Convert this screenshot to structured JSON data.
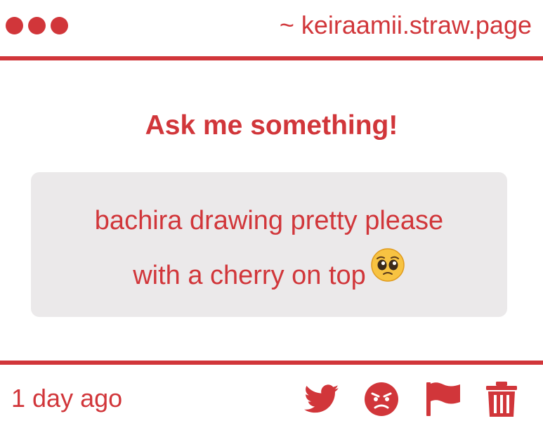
{
  "header": {
    "url": "~ keiraamii.straw.page",
    "window_controls": [
      "dot",
      "dot",
      "dot"
    ]
  },
  "prompt": {
    "title": "Ask me something!"
  },
  "question": {
    "line1": "bachira drawing pretty please",
    "line2": "with a cherry on top",
    "emoji_icon": "pleading-face-icon"
  },
  "footer": {
    "timestamp": "1 day ago",
    "actions": [
      {
        "name": "share-twitter",
        "icon": "twitter-bird-icon"
      },
      {
        "name": "angry-reaction",
        "icon": "angry-face-icon"
      },
      {
        "name": "report",
        "icon": "flag-icon"
      },
      {
        "name": "delete",
        "icon": "trash-icon"
      }
    ]
  },
  "colors": {
    "accent": "#d1363a",
    "card_background": "#ebe9ea",
    "page_background": "#ffffff"
  }
}
